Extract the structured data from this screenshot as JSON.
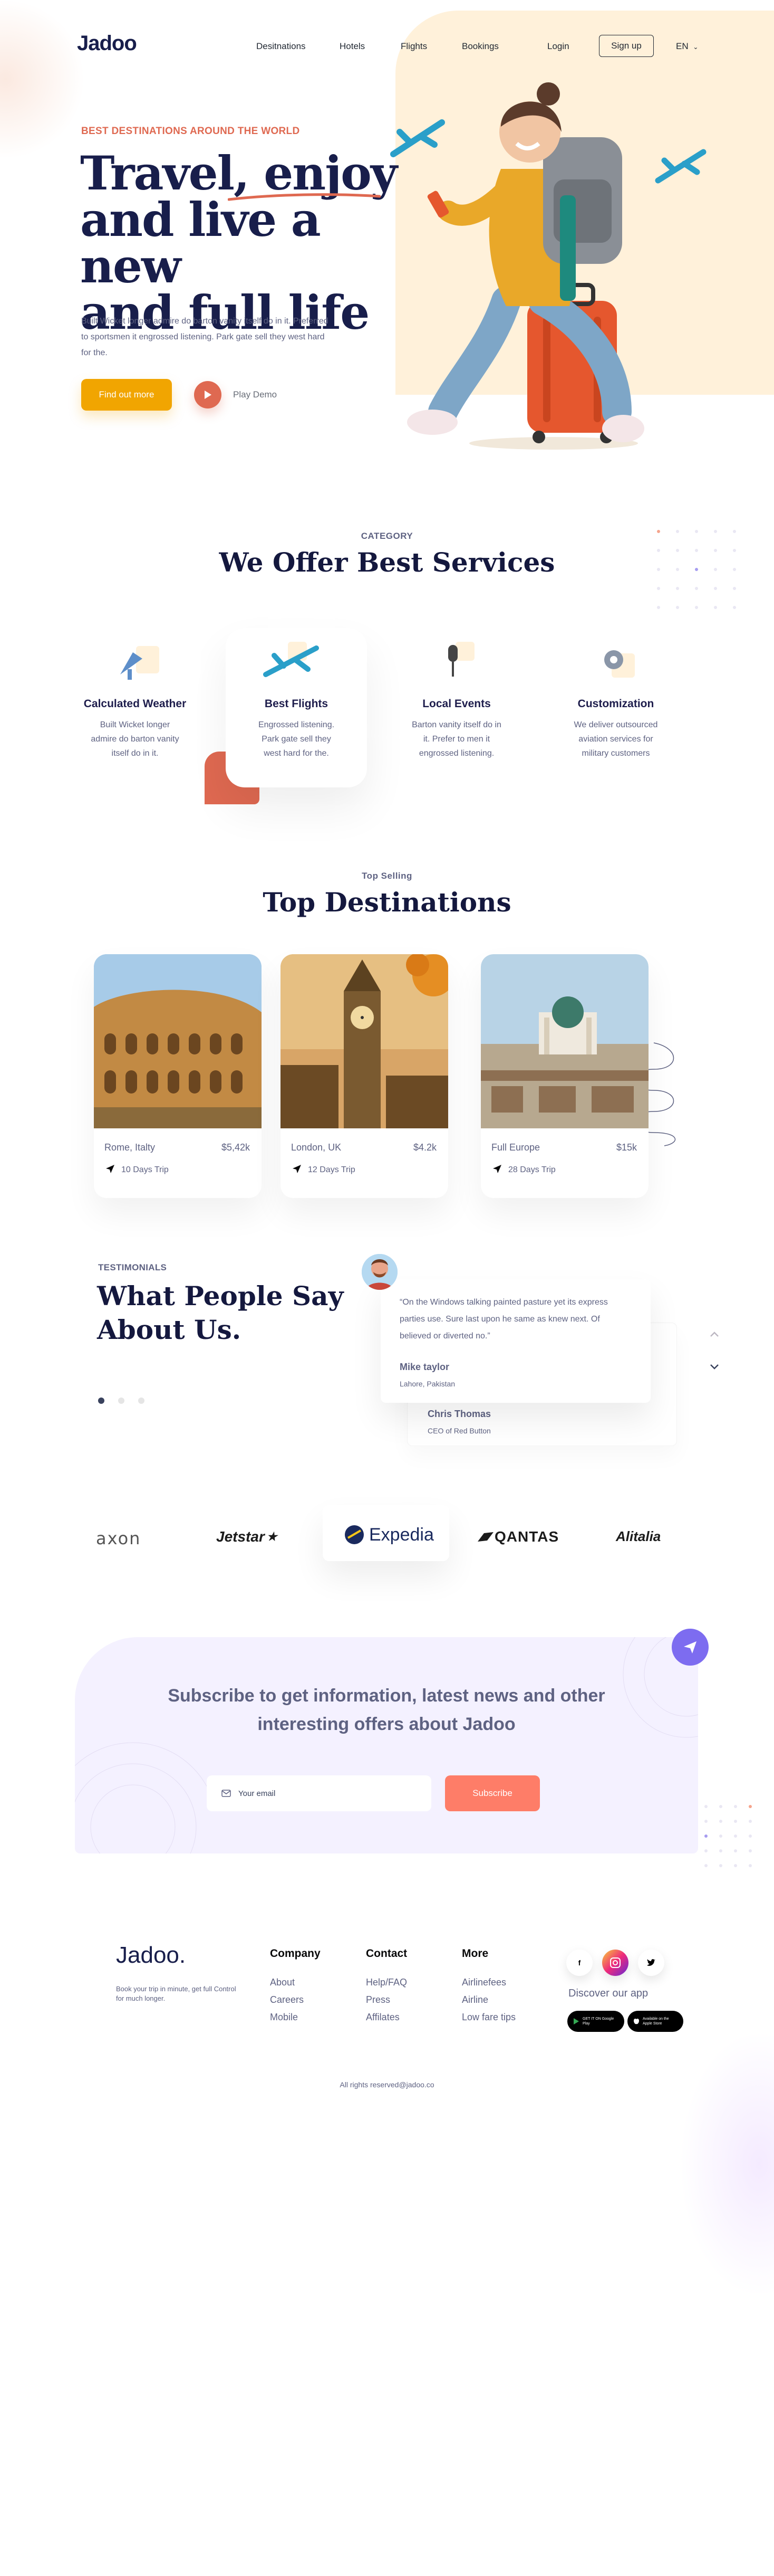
{
  "nav": {
    "logo": "Jadoo",
    "links": [
      "Desitnations",
      "Hotels",
      "Flights",
      "Bookings"
    ],
    "login": "Login",
    "signup": "Sign up",
    "lang": "EN"
  },
  "hero": {
    "eyebrow": "BEST DESTINATIONS AROUND THE WORLD",
    "title_line1_a": "Travel, ",
    "title_line1_b": "enjoy",
    "title_line2": "and live a new",
    "title_line3": "and full life",
    "subtitle": "Built Wicket longer admire do barton vanity itself do in it. Preferred to sportsmen it engrossed listening. Park gate sell they west hard for the.",
    "cta": "Find out more",
    "play_label": "Play Demo"
  },
  "services": {
    "eyebrow": "CATEGORY",
    "title": "We Offer Best Services",
    "items": [
      {
        "title": "Calculated Weather",
        "desc": "Built Wicket longer admire do barton vanity itself do in it.",
        "icon": "satellite-dish-icon"
      },
      {
        "title": "Best Flights",
        "desc": "Engrossed listening. Park gate sell they west hard for the.",
        "icon": "airplane-icon"
      },
      {
        "title": "Local Events",
        "desc": "Barton vanity itself do in it. Prefer to men it engrossed listening.",
        "icon": "microphone-icon"
      },
      {
        "title": "Customization",
        "desc": "We deliver outsourced aviation services for military customers",
        "icon": "gear-icon"
      }
    ]
  },
  "destinations": {
    "eyebrow": "Top Selling",
    "title": "Top Destinations",
    "items": [
      {
        "name": "Rome, Italty",
        "price": "$5,42k",
        "trip": "10 Days Trip"
      },
      {
        "name": "London, UK",
        "price": "$4.2k",
        "trip": "12 Days Trip"
      },
      {
        "name": "Full Europe",
        "price": "$15k",
        "trip": "28 Days Trip"
      }
    ]
  },
  "testimonials": {
    "eyebrow": "TESTIMONIALS",
    "title_line1": "What People Say",
    "title_line2": "About Us.",
    "front": {
      "quote": "“On the Windows talking painted pasture yet its express parties use. Sure last upon he same as knew next. Of believed or diverted no.”",
      "name": "Mike taylor",
      "role": "Lahore, Pakistan"
    },
    "back": {
      "name": "Chris Thomas",
      "role": "CEO of Red Button"
    }
  },
  "brands": [
    "axon",
    "Jetstar",
    "Expedia",
    "QANTAS",
    "Alitalia"
  ],
  "subscribe": {
    "title_line1": "Subscribe to get information, latest news and other",
    "title_line2": "interesting offers about Jadoo",
    "placeholder": "Your email",
    "button": "Subscribe"
  },
  "footer": {
    "logo": "Jadoo.",
    "tagline": "Book your trip in minute, get full Control for much longer.",
    "columns": [
      {
        "heading": "Company",
        "links": [
          "About",
          "Careers",
          "Mobile"
        ]
      },
      {
        "heading": "Contact",
        "links": [
          "Help/FAQ",
          "Press",
          "Affilates"
        ]
      },
      {
        "heading": "More",
        "links": [
          "Airlinefees",
          "Airline",
          "Low fare tips"
        ]
      }
    ],
    "discover": "Discover our app",
    "google_play": "GET IT ON Google Play",
    "app_store": "Available on the Apple Store",
    "copyright": "All rights reserved@jadoo.co"
  },
  "colors": {
    "navy": "#181e4b",
    "orange": "#df6951",
    "yellow": "#f1a501",
    "salmon": "#fe7d68",
    "lavender": "#f4f1ff",
    "purple": "#7d6cf0",
    "cream": "#fff1da"
  }
}
